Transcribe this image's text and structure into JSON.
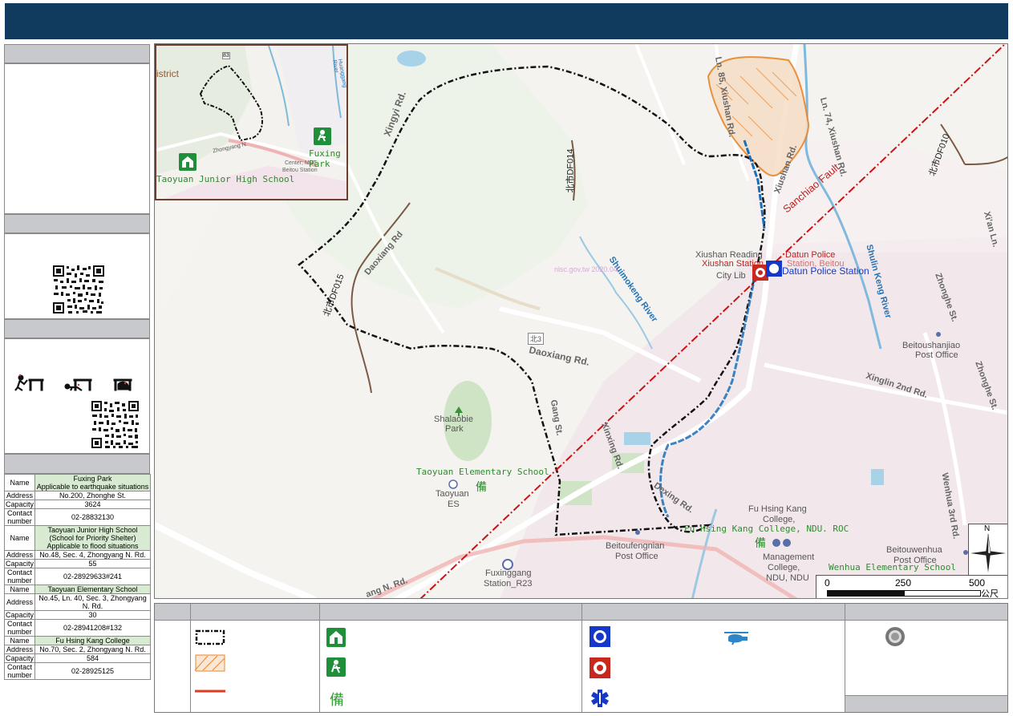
{
  "header": {
    "title": ""
  },
  "left_panel": {
    "qr_section_1": {
      "alt": "qr-code"
    },
    "qr_section_2": {
      "alt": "qr-code"
    },
    "table": {
      "rows": [
        {
          "label": "Name",
          "value": "Fuxing Park\nApplicable to earthquake situations",
          "highlight": true
        },
        {
          "label": "Address",
          "value": "No.200, Zhonghe St."
        },
        {
          "label": "Capacity",
          "value": "3624"
        },
        {
          "label": "Contact number",
          "value": "02-28832130"
        },
        {
          "label": "Name",
          "value": "Taoyuan Junior High School\n(School for Priority Shelter)\nApplicable to flood situations",
          "highlight": true
        },
        {
          "label": "Address",
          "value": "No.48, Sec. 4, Zhongyang N. Rd."
        },
        {
          "label": "Capacity",
          "value": "55"
        },
        {
          "label": "Contact number",
          "value": "02-28929633#241"
        },
        {
          "label": "Name",
          "value": "Taoyuan Elementary School",
          "highlight": true
        },
        {
          "label": "Address",
          "value": "No.45, Ln. 40, Sec. 3, Zhongyang N. Rd."
        },
        {
          "label": "Capacity",
          "value": "30"
        },
        {
          "label": "Contact number",
          "value": "02-28941208#132"
        },
        {
          "label": "Name",
          "value": "Fu Hsing Kang College",
          "highlight": true
        },
        {
          "label": "Address",
          "value": "No.70, Sec. 2, Zhongyang N. Rd."
        },
        {
          "label": "Capacity",
          "value": "584"
        },
        {
          "label": "Contact number",
          "value": "02-28925125"
        }
      ]
    }
  },
  "map": {
    "labels": {
      "xiushan_reading": "Xiushan Reading",
      "xiushan_station": "Xiushan Station",
      "city_lib": "City Lib",
      "datun_police_a": "Datun Police",
      "datun_police_b": "Station, Beitou",
      "datun_police_station": "Datun Police Station",
      "beitoushanjiao": "Beitoushanjiao",
      "post_office": "Post Office",
      "sanchiao_fault": "Sanchiao Fault",
      "shalaobie": "Shalaobie",
      "park": "Park",
      "taoyuan_es_school": "Taoyuan Elementary School",
      "taoyuan": "Taoyuan",
      "es": "ES",
      "fu_hsing_kang_a": "Fu Hsing Kang",
      "fu_hsing_kang_b": "College,",
      "fu_hsing_kang_college_green": "Fu Hsing Kang College, NDU. ROC",
      "management_a": "Management",
      "management_b": "College,",
      "management_c": "NDU, NDU",
      "beitoufengnian": "Beitoufengnian",
      "fuxinggang": "Fuxinggang",
      "station_r23": "Station_R23",
      "beitouwenhua": "Beitouwenhua",
      "wenhua_es": "Wenhua Elementary School",
      "daoxiang_rd": "Daoxiang Rd.",
      "daoxiang_rd2": "Daoxiang Rd",
      "xingyi_rd": "Xingyi Rd.",
      "xinglin": "Xinglin 2nd Rd.",
      "zhonghe_st": "Zhonghe St.",
      "zhonghe_st2": "Zhonghe St.",
      "wenhua_3rd": "Wenhua 3rd Rd.",
      "xiuan_ln": "Xi'an Ln.",
      "shuimokeng": "Shuimokeng River",
      "shulin": "Shulin Keng River",
      "xiushan_rd": "Ln. 85, Xiushan Rd.",
      "xiushan_rd2": "Xiushan Rd.",
      "ln74": "Ln. 74, Xiushan Rd.",
      "gang_st": "Gang St.",
      "xinxing": "Xinxing Rd.",
      "dexing": "Dexing Rd.",
      "zhongyang_rd": "ang N. Rd.",
      "route_bei3": "北3",
      "df014": "北市DF014",
      "df015": "北市DF015",
      "df010": "北市DF010",
      "watermark": "nlsc.gov.tw 2020.04",
      "bei_char": "備",
      "bei_char2": "備"
    },
    "inset": {
      "district": "istrict",
      "fuxing_park": "Fuxing Park",
      "taoyuan_jhs": "Taoyuan Junior High School",
      "center_mrt": "Center; MRT",
      "beitou_station": "Beitou Station",
      "route": "83",
      "zhongyang": "Zhongyang N.",
      "river": "Huanggang River"
    },
    "scale": {
      "t0": "0",
      "t1": "250",
      "t2": "500",
      "unit": "公尺"
    },
    "compass": {
      "n": "N"
    }
  },
  "legend": {
    "bei_char": "備"
  },
  "colors": {
    "header_bg": "#113a5f",
    "highlight_row": "#d9ead3",
    "fault_line": "#cc1111",
    "evac_boundary": "#111111",
    "hazard_zone": "#e8862a",
    "shelter_green": "#1f8f3a",
    "police_blue": "#1638c8",
    "fire_red": "#c8281e"
  }
}
